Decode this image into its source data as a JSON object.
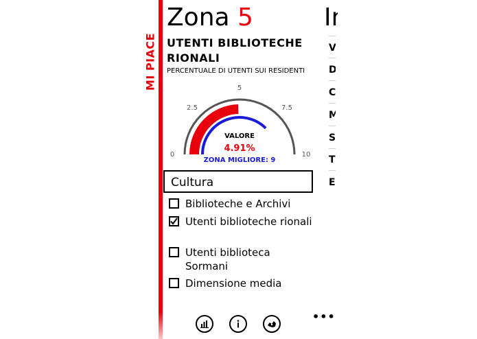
{
  "sidebar": {
    "vertical_label": "MI PIACE"
  },
  "header": {
    "zone_word": "Zona",
    "zone_number": "5",
    "next_column_title": "In"
  },
  "indicator": {
    "title": "UTENTI BIBLIOTECHE RIONALI",
    "subtitle": "PERCENTUALE DI UTENTI SUI RESIDENTI"
  },
  "gauge": {
    "min": 0,
    "max": 10,
    "tick_labels": [
      "0",
      "2.5",
      "5",
      "7.5",
      "10"
    ],
    "value": 4.91,
    "best_value": 7.5,
    "value_caption": "VALORE",
    "value_text": "4.91%",
    "best_zone_text": "ZONA MIGLIORE:  9",
    "colors": {
      "value": "#e8000d",
      "best": "#1a1adb",
      "frame": "#555555"
    }
  },
  "category": {
    "selected": "Cultura"
  },
  "checklist": [
    {
      "label": "Biblioteche e Archivi",
      "checked": false
    },
    {
      "label": "Utenti biblioteche rionali",
      "checked": true
    },
    {
      "label": "Utenti biblioteca Sormani",
      "checked": false
    },
    {
      "label": "Dimensione media",
      "checked": false
    }
  ],
  "right_column": {
    "letters": [
      "V",
      "D",
      "C",
      "M",
      "S",
      "T",
      "E"
    ]
  },
  "appbar": {
    "buttons": [
      "chart-icon",
      "info-icon",
      "map-icon"
    ],
    "more": "•••"
  },
  "colors": {
    "accent": "#e8000d"
  }
}
